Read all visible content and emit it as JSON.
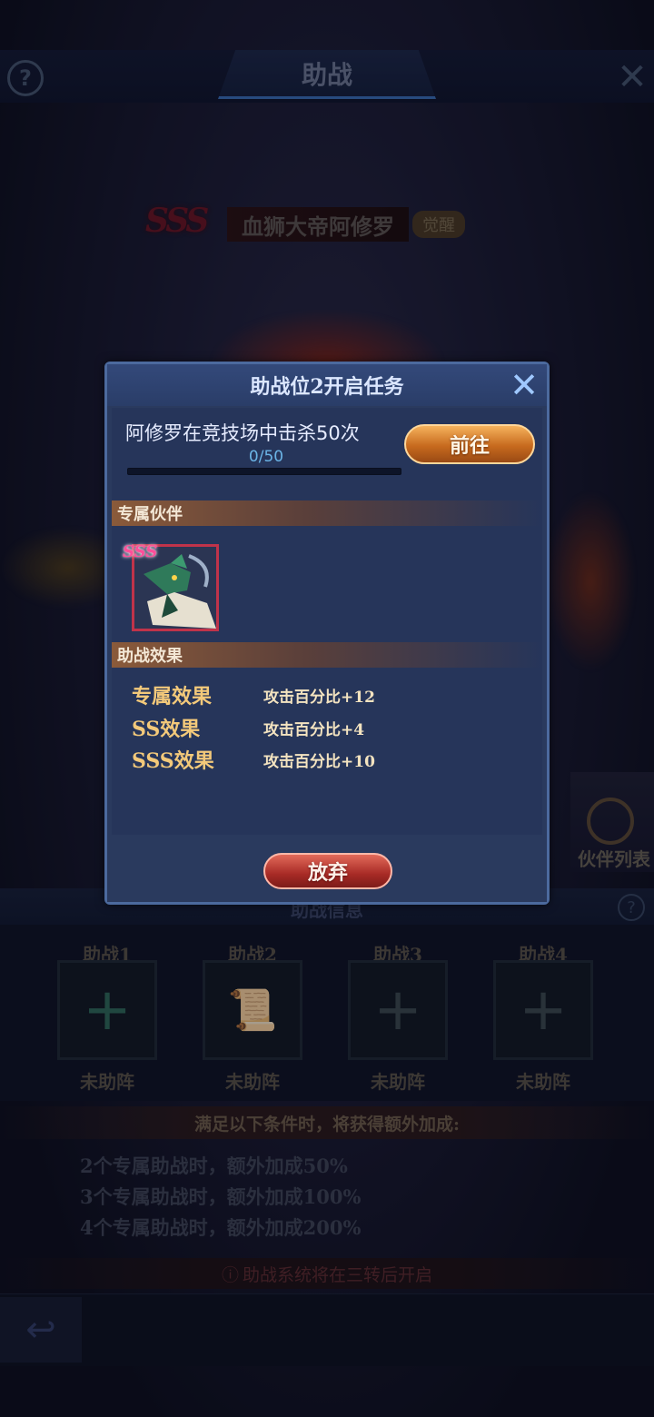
{
  "screen": {
    "title": "助战",
    "hero": {
      "rank": "SSS",
      "name": "血狮大帝阿修罗",
      "tag": "觉醒"
    },
    "partner_list_label": "伙伴列表",
    "assist_panel_title": "助战信息",
    "slots": [
      {
        "label": "助战1",
        "status": "未助阵"
      },
      {
        "label": "助战2",
        "status": "未助阵"
      },
      {
        "label": "助战3",
        "status": "未助阵"
      },
      {
        "label": "助战4",
        "status": "未助阵"
      }
    ],
    "bonus_header": "满足以下条件时，将获得额外加成:",
    "bonus_lines": [
      "2个专属助战时，额外加成50%",
      "3个专属助战时，额外加成100%",
      "4个专属助战时，额外加成200%"
    ],
    "notice": "助战系统将在三转后开启"
  },
  "modal": {
    "title": "助战位2开启任务",
    "task": "阿修罗在竞技场中击杀50次",
    "progress_text": "0/50",
    "progress_fraction": 0.0,
    "goto_label": "前往",
    "partner_section": "专属伙伴",
    "partner_rank": "SSS",
    "effect_section": "助战效果",
    "effects": [
      {
        "name": "专属效果",
        "value": "攻击百分比+12"
      },
      {
        "name": "SS效果",
        "value": "攻击百分比+4"
      },
      {
        "name": "SSS效果",
        "value": "攻击百分比+10"
      }
    ],
    "abandon_label": "放弃"
  },
  "icons": {
    "help": "help-icon",
    "close": "close-icon",
    "back": "back-arrow-icon",
    "add": "plus-icon"
  },
  "colors": {
    "accent_gold": "#f3c97a",
    "progress_blue": "#2ba2e8",
    "modal_bg": "#2a3a5e"
  }
}
